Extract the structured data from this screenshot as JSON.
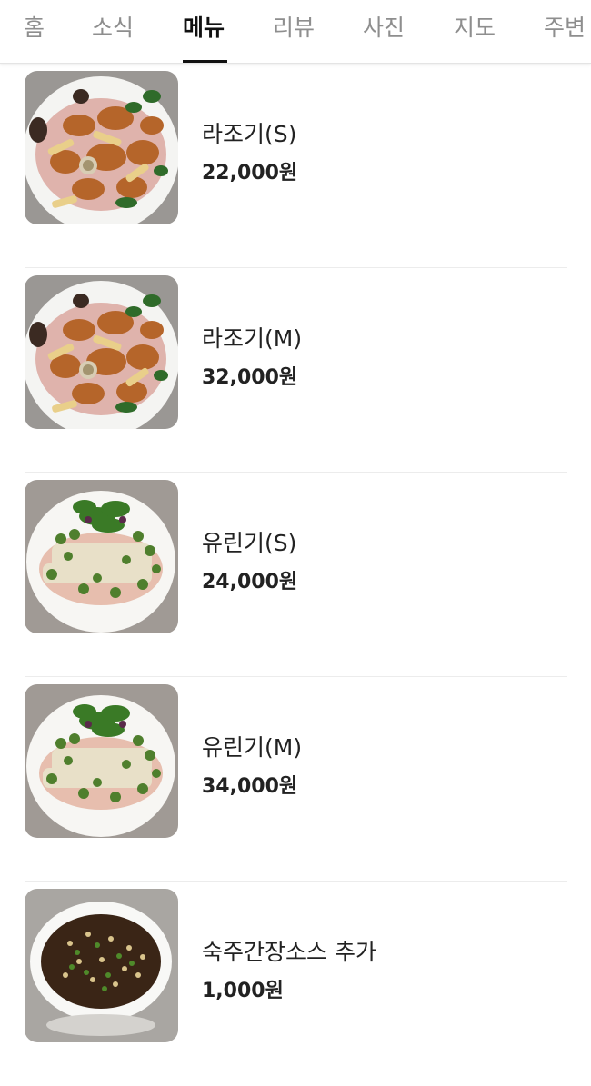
{
  "tabs": [
    {
      "label": "홈",
      "active": false
    },
    {
      "label": "소식",
      "active": false
    },
    {
      "label": "메뉴",
      "active": true
    },
    {
      "label": "리뷰",
      "active": false
    },
    {
      "label": "사진",
      "active": false
    },
    {
      "label": "지도",
      "active": false
    },
    {
      "label": "주변",
      "active": false
    }
  ],
  "menu": {
    "items": [
      {
        "name": "라조기(S)",
        "price": "22,000원",
        "image": "spicy-chicken-dish"
      },
      {
        "name": "라조기(M)",
        "price": "32,000원",
        "image": "spicy-chicken-dish"
      },
      {
        "name": "유린기(S)",
        "price": "24,000원",
        "image": "fried-chicken-with-greens"
      },
      {
        "name": "유린기(M)",
        "price": "34,000원",
        "image": "fried-chicken-with-greens"
      },
      {
        "name": "숙주간장소스 추가",
        "price": "1,000원",
        "image": "soy-sauce-bowl"
      }
    ]
  },
  "colors": {
    "active_tab": "#111111",
    "inactive_tab": "#8e8e8e",
    "divider": "#ececec"
  }
}
